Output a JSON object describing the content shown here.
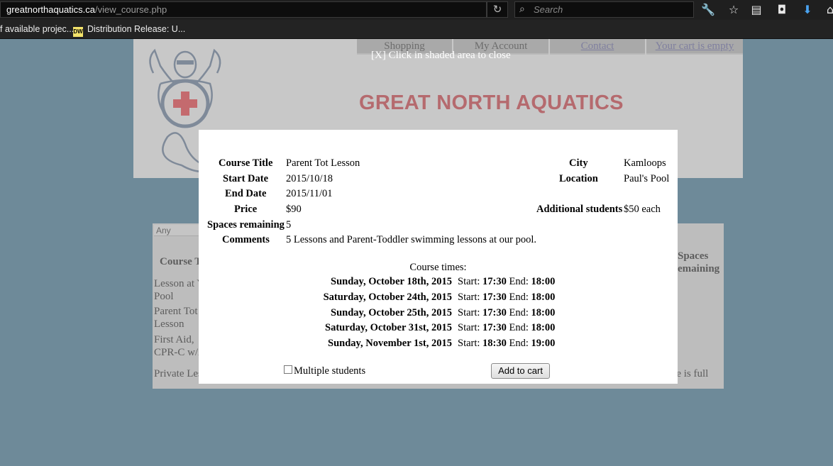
{
  "browser": {
    "url_domain": "greatnorthaquatics.ca",
    "url_path": "/view_course.php",
    "reload_icon": "reload-icon",
    "search_placeholder": "Search",
    "toolbar_icons": [
      "wrench-icon",
      "star-icon",
      "reader-icon",
      "pocket-icon",
      "download-icon",
      "home-icon"
    ],
    "bookmarks": [
      {
        "label": "f available projec...",
        "icon": ""
      },
      {
        "label": "Distribution Release: U...",
        "icon": "DW"
      }
    ]
  },
  "header": {
    "site_title": "GREAT NORTH AQUATICS",
    "nav": [
      "Shopping",
      "My Account",
      "Contact",
      "Your cart is empty"
    ],
    "title_color": "#b56a6e"
  },
  "overlay": {
    "close_text": "[X] Click in shaded area to close"
  },
  "course_list": {
    "filter_value": "Any",
    "col_course": "Course T",
    "col_spaces_1": "Spaces",
    "col_spaces_2": "emaining",
    "rows": [
      {
        "line1": "Lesson at Y",
        "line2": "Pool"
      },
      {
        "line1": "Parent Tot",
        "line2": "Lesson"
      },
      {
        "line1": "First Aid,",
        "line2": "CPR-C w/A"
      },
      {
        "line1": "Private Les",
        "line2": ""
      }
    ],
    "full_note": "urse is full"
  },
  "modal": {
    "labels": {
      "course_title": "Course Title",
      "start_date": "Start Date",
      "end_date": "End Date",
      "price": "Price",
      "spaces": "Spaces remaining",
      "comments": "Comments",
      "city": "City",
      "location": "Location",
      "additional": "Additional students"
    },
    "values": {
      "course_title": "Parent Tot Lesson",
      "start_date": "2015/10/18",
      "end_date": "2015/11/01",
      "price": "$90",
      "spaces": "5",
      "comments": "5 Lessons and Parent-Toddler swimming lessons at our pool.",
      "city": "Kamloops",
      "location": "Paul's Pool",
      "additional": "$50 each"
    },
    "times_heading": "Course times:",
    "start_label": "Start:",
    "end_label": "End:",
    "times": [
      {
        "day": "Sunday, October 18th, 2015",
        "start": "17:30",
        "end": "18:00"
      },
      {
        "day": "Saturday, October 24th, 2015",
        "start": "17:30",
        "end": "18:00"
      },
      {
        "day": "Sunday, October 25th, 2015",
        "start": "17:30",
        "end": "18:00"
      },
      {
        "day": "Saturday, October 31st, 2015",
        "start": "17:30",
        "end": "18:00"
      },
      {
        "day": "Sunday, November 1st, 2015",
        "start": "18:30",
        "end": "19:00"
      }
    ],
    "multiple_students_label": "Multiple students",
    "multiple_students_checked": false,
    "add_to_cart_label": "Add to cart"
  }
}
